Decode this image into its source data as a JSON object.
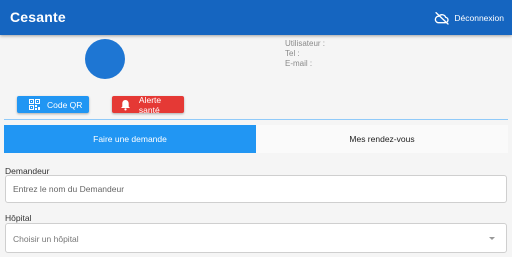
{
  "app": {
    "title": "Cesante"
  },
  "header": {
    "logout_label": "Déconnexion",
    "logout_icon": "cloud-off-icon"
  },
  "profile": {
    "avatar_color": "#1e76d3",
    "user_label": "Utilisateur :",
    "tel_label": "Tel :",
    "email_label": "E-mail :"
  },
  "actions": {
    "qr_label": "Code QR",
    "qr_icon": "qr-code-icon",
    "alert_label": "Alerte santé",
    "alert_icon": "bell-icon"
  },
  "tabs": [
    {
      "label": "Faire une demande",
      "active": true
    },
    {
      "label": "Mes rendez-vous",
      "active": false
    }
  ],
  "form": {
    "requester_label": "Demandeur",
    "requester_placeholder": "Entrez le nom du Demandeur",
    "hospital_label": "Hôpital",
    "hospital_placeholder": "Choisir un hôpital"
  },
  "colors": {
    "appbar": "#1565c0",
    "primary": "#2196f3",
    "danger": "#e53935"
  }
}
